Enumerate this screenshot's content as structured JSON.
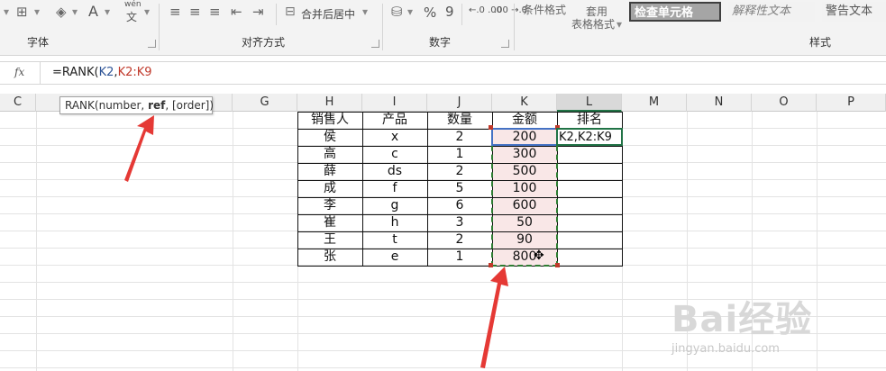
{
  "ribbon": {
    "font_group_label": "字体",
    "align_group_label": "对齐方式",
    "number_group_label": "数字",
    "styles_group_label": "样式",
    "font_color_letter": "A",
    "wen_label": "wén",
    "wen_char": "文",
    "merge_center_label": "合并后居中",
    "percent_label": "%",
    "comma_label": "9",
    "decimal_inc_label": "←.0 .00",
    "decimal_dec_label": ".00 →.0",
    "conditional_format_label": "条件格式",
    "table_format_line1": "套用",
    "table_format_line2": "表格格式",
    "style_check_cell": "检查单元格",
    "style_explanatory": "解释性文本",
    "style_warning": "警告文本",
    "colors": {
      "check_cell_bg": "#a5a5a5",
      "check_cell_border": "#3f3f3f"
    }
  },
  "formula_bar": {
    "fx_label": "fx",
    "formula_parts": [
      "=RANK(",
      "K2",
      ",",
      "K2:K9"
    ]
  },
  "tooltip": {
    "prefix": "RANK(number, ",
    "bold": "ref",
    "suffix": ", [order])"
  },
  "columns": [
    "C",
    "G",
    "H",
    "I",
    "J",
    "K",
    "L",
    "M",
    "N",
    "O",
    "P"
  ],
  "table": {
    "headers": [
      "销售人",
      "产品",
      "数量",
      "金额",
      "排名"
    ],
    "rows": [
      [
        "侯",
        "x",
        "2",
        "200",
        "K2,K2:K9"
      ],
      [
        "高",
        "c",
        "1",
        "300",
        ""
      ],
      [
        "薛",
        "ds",
        "2",
        "500",
        ""
      ],
      [
        "成",
        "f",
        "5",
        "100",
        ""
      ],
      [
        "李",
        "g",
        "6",
        "600",
        ""
      ],
      [
        "崔",
        "h",
        "3",
        "50",
        ""
      ],
      [
        "王",
        "t",
        "2",
        "90",
        ""
      ],
      [
        "张",
        "e",
        "1",
        "800",
        ""
      ]
    ]
  },
  "watermark": {
    "text": "Bai经验",
    "sub": "jingyan.baidu.com"
  }
}
